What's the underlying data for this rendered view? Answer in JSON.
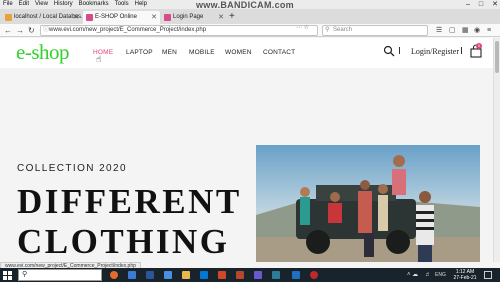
{
  "browser": {
    "menu": [
      "File",
      "Edit",
      "View",
      "History",
      "Bookmarks",
      "Tools",
      "Help"
    ],
    "watermark": "www.BANDICAM.com",
    "tabs": [
      {
        "title": "localhost / Local Databas...",
        "favicon_color": "#e8a23a"
      },
      {
        "title": "E-SHOP Online",
        "favicon_color": "#d94a8c"
      },
      {
        "title": "Login Page",
        "favicon_color": "#d94a8c"
      }
    ],
    "url": "www.evi.com/new_project/E_Commerce_Project/index.php",
    "search_placeholder": "Search",
    "status_url": "www.evi.com/new_project/E_Commerce_Project/index.php"
  },
  "site": {
    "logo": "e-shop",
    "nav": [
      "HOME",
      "LAPTOP",
      "MEN",
      "MOBILE",
      "WOMEN",
      "CONTACT"
    ],
    "login_label": "Login/Register",
    "cart_count": "0",
    "accent_color": "#e0447b",
    "logo_color": "#33d12a"
  },
  "hero": {
    "collection": "COLLECTION 2020",
    "headline_line1": "DIFFERENT",
    "headline_line2": "CLOTHING"
  },
  "taskbar": {
    "search_placeholder": "Type here to search",
    "time": "1:12 AM",
    "date": "27-Feb-21",
    "language": "ENG"
  }
}
